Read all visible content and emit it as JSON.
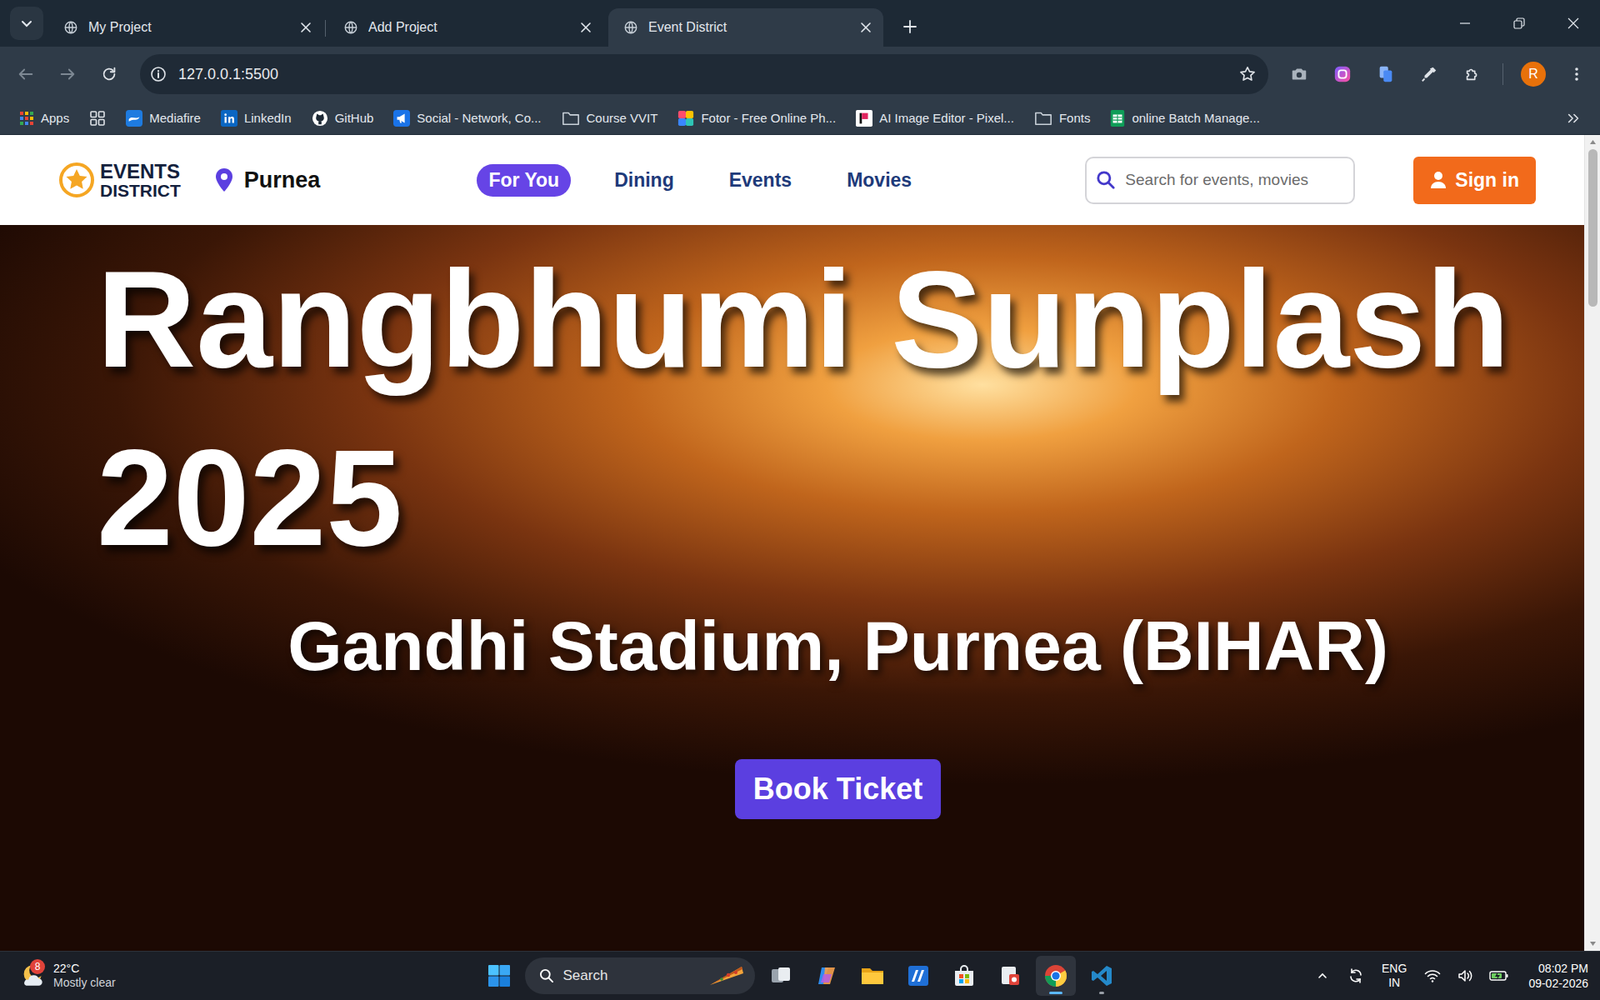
{
  "browser": {
    "tabs": [
      {
        "label": "My Project",
        "selected": false
      },
      {
        "label": "Add Project",
        "selected": false
      },
      {
        "label": "Event District",
        "selected": true
      }
    ],
    "address": "127.0.0.1:5500",
    "profile_initial": "R",
    "bookmarks": [
      {
        "label": "Apps",
        "kind": "apps"
      },
      {
        "kind": "tabgroups"
      },
      {
        "label": "Mediafire",
        "kind": "mediafire"
      },
      {
        "label": "LinkedIn",
        "kind": "linkedin"
      },
      {
        "label": "GitHub",
        "kind": "github"
      },
      {
        "label": "Social - Network, Co...",
        "kind": "social"
      },
      {
        "label": "Course VVIT",
        "kind": "folder"
      },
      {
        "label": "Fotor - Free Online Ph...",
        "kind": "fotor"
      },
      {
        "label": "AI Image Editor - Pixel...",
        "kind": "pixel"
      },
      {
        "label": "Fonts",
        "kind": "folder"
      },
      {
        "label": "online Batch Manage...",
        "kind": "sheets"
      }
    ],
    "scrollbar": {
      "level": 0.2
    }
  },
  "page": {
    "logo": [
      "EVENTS",
      "DISTRICT"
    ],
    "location": "Purnea",
    "nav": [
      {
        "label": "For You",
        "selected": true
      },
      {
        "label": "Dining",
        "selected": false
      },
      {
        "label": "Events",
        "selected": false
      },
      {
        "label": "Movies",
        "selected": false
      }
    ],
    "search": {
      "placeholder": "Search for events, movies"
    },
    "sign_in": "Sign in",
    "hero": {
      "title": "Rangbhumi Sunplash 2025",
      "venue": "Gandhi Stadium, Purnea (BIHAR)",
      "button": "Book Ticket"
    }
  },
  "taskbar": {
    "weather": {
      "temp": "22°C",
      "condition": "Mostly clear",
      "badge": "8"
    },
    "search": "Search",
    "apps": [
      {
        "kind": "taskview",
        "running": false,
        "active": false
      },
      {
        "kind": "copilot",
        "running": false,
        "active": false
      },
      {
        "kind": "explorer",
        "running": false,
        "active": false
      },
      {
        "kind": "bluetool",
        "running": false,
        "active": false
      },
      {
        "kind": "store",
        "running": false,
        "active": false
      },
      {
        "kind": "snip",
        "running": false,
        "active": false
      },
      {
        "kind": "chrome",
        "running": true,
        "active": true
      },
      {
        "kind": "vscode",
        "running": true,
        "active": false
      }
    ],
    "tray": {
      "language": "ENG",
      "region": "IN",
      "time": "08:02 PM",
      "date": "09-02-2026"
    }
  }
}
